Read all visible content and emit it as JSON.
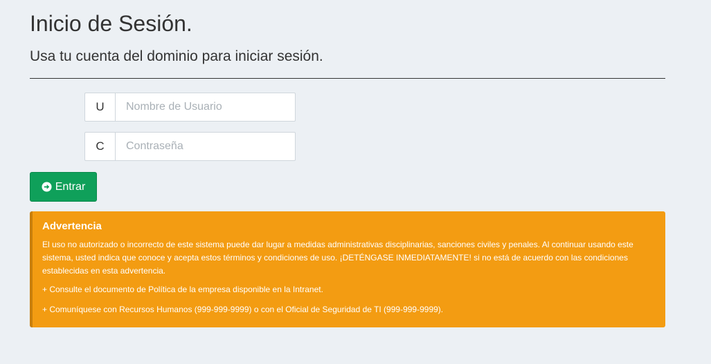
{
  "header": {
    "title": "Inicio de Sesión.",
    "subtitle": "Usa tu cuenta del dominio para iniciar sesión."
  },
  "login_form": {
    "username": {
      "addon": "U",
      "placeholder": "Nombre de Usuario",
      "value": ""
    },
    "password": {
      "addon": "C",
      "placeholder": "Contraseña",
      "value": ""
    },
    "submit": {
      "label": "Entrar",
      "icon": "arrow-circle-right-icon"
    }
  },
  "warning": {
    "title": "Advertencia",
    "body": "El uso no autorizado o incorrecto de este sistema puede dar lugar a medidas administrativas disciplinarias, sanciones civiles y penales. Al continuar usando este sistema, usted indica que conoce y acepta estos términos y condiciones de uso. ¡DETÉNGASE INMEDIATAMENTE! si no está de acuerdo con las condiciones establecidas en esta advertencia.",
    "lines": [
      "+ Consulte el documento de Política de la empresa disponible en la Intranet.",
      "+ Comuníquese con Recursos Humanos (999-999-9999) o con el Oficial de Seguridad de TI (999-999-9999)."
    ]
  },
  "colors": {
    "background": "#ecf0f4",
    "button_green": "#0fa05a",
    "warning_orange": "#f39c12"
  }
}
